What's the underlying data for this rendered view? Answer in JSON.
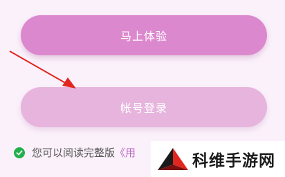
{
  "buttons": {
    "try_now": "马上体验",
    "account_login": "帐号登录"
  },
  "agreement": {
    "text": "您可以阅读完整版",
    "link_fragment": "《用"
  },
  "watermark": {
    "text": "科维手游网"
  },
  "icons": {
    "check": "check-circle-icon",
    "arrow": "red-arrow-annotation",
    "logo": "triangle-logo-icon"
  },
  "colors": {
    "primary_button": "#dc88ce",
    "secondary_button": "#e6b4dc",
    "check_green": "#22b04a",
    "link": "#b86ac0",
    "arrow_red": "#e0261f"
  }
}
